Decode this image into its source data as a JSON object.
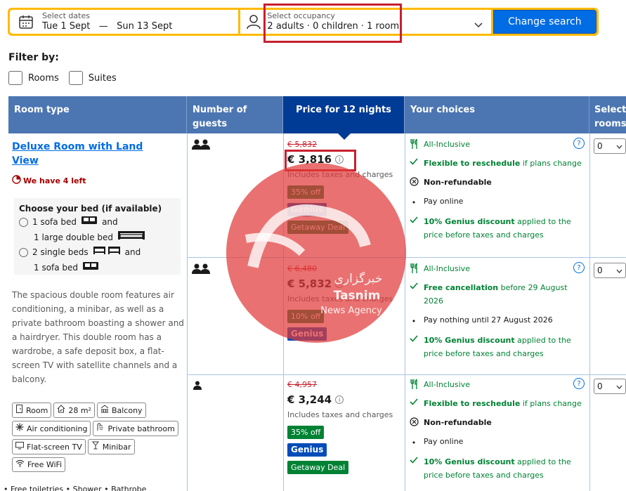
{
  "search": {
    "dates_label": "Select dates",
    "check_in": "Tue 1 Sept",
    "dash": "—",
    "check_out": "Sun 13 Sept",
    "occupancy_label": "Select occupancy",
    "occupancy_value": "2 adults · 0 children · 1 room",
    "button": "Change search"
  },
  "filter": {
    "title": "Filter by:",
    "options": [
      "Rooms",
      "Suites"
    ]
  },
  "table": {
    "headers": {
      "room_type": "Room type",
      "guests": "Number of guests",
      "price": "Price for 12 nights",
      "choices": "Your choices",
      "select": "Select rooms"
    },
    "room": {
      "name": "Deluxe Room with Land View",
      "scarcity": "We have 4 left",
      "bed_title": "Choose your bed (if available)",
      "bed_option_1a": "1 sofa bed",
      "bed_option_1b": "1 large double bed",
      "bed_option_2a": "2 single beds",
      "bed_option_2b": "1 sofa bed",
      "and": "and",
      "description": "The spacious double room features air conditioning, a minibar, as well as a private bathroom boasting a shower and a hairdryer. This double room has a wardrobe, a safe deposit box, a flat-screen TV with satellite channels and a balcony.",
      "facilities": [
        "Room",
        "28 m²",
        "Balcony",
        "Air conditioning",
        "Private bathroom",
        "Flat-screen TV",
        "Minibar",
        "Free WiFi"
      ],
      "more": "• Free toiletries • Shower • Bathrobe"
    },
    "offers": [
      {
        "old_price": "€ 5,832",
        "price": "€ 3,816",
        "tax": "Includes taxes and charges",
        "badges": [
          "35% off",
          "Genius",
          "Getaway Deal"
        ],
        "meal": "All-Inclusive",
        "policy_bold": "Flexible to reschedule",
        "policy_rest": " if plans change",
        "refund": "Non-refundable",
        "payment": "Pay online",
        "genius_bold": "10% Genius discount",
        "genius_rest": " applied to the price before taxes and charges",
        "select": "0"
      },
      {
        "old_price": "€ 6,480",
        "price": "€ 5,832",
        "tax": "Includes taxes and charges",
        "badges": [
          "10% off",
          "Genius"
        ],
        "meal": "All-Inclusive",
        "policy_bold": "Free cancellation",
        "policy_rest": " before 29 August 2026",
        "payment": "Pay nothing until 27 August 2026",
        "genius_bold": "10% Genius discount",
        "genius_rest": " applied to the price before taxes and charges",
        "select": "0"
      },
      {
        "old_price": "€ 4,957",
        "price": "€ 3,244",
        "tax": "Includes taxes and charges",
        "badges": [
          "35% off",
          "Genius",
          "Getaway Deal"
        ],
        "meal": "All-Inclusive",
        "policy_bold": "Flexible to reschedule",
        "policy_rest": " if plans change",
        "refund": "Non-refundable",
        "payment": "Pay online",
        "genius_bold": "10% Genius discount",
        "genius_rest": " applied to the price before taxes and charges",
        "select": "0"
      }
    ]
  },
  "watermark": {
    "text_fa": "خبرگزاری",
    "text_en_1": "Tasnim",
    "text_en_2": "News Agency"
  },
  "colors": {
    "brand_blue": "#006ce4",
    "header_blue": "#4c76b2",
    "dark_blue": "#003b95",
    "yellow": "#febb02",
    "green": "#008234",
    "red": "#c8202f"
  }
}
